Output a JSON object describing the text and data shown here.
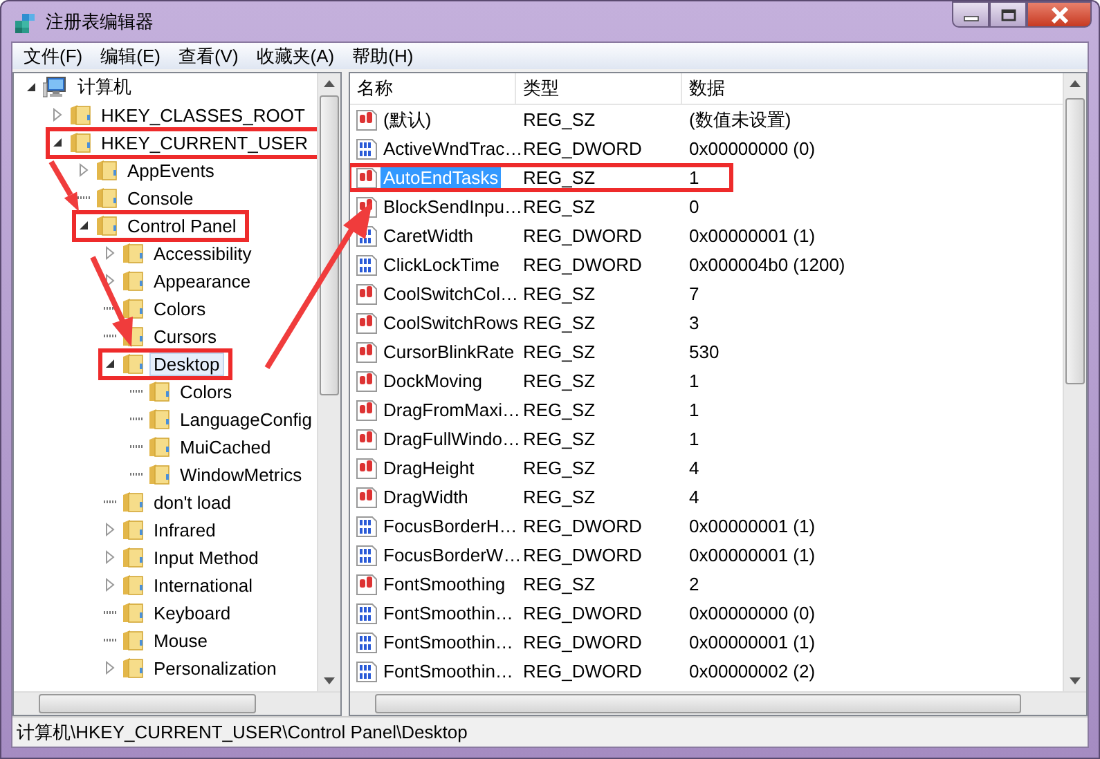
{
  "window": {
    "title": "注册表编辑器"
  },
  "menu": [
    "文件(F)",
    "编辑(E)",
    "查看(V)",
    "收藏夹(A)",
    "帮助(H)"
  ],
  "tree": [
    {
      "label": "计算机",
      "kind": "computer",
      "expandable": true,
      "expanded": true,
      "selected": false,
      "highlighted": false,
      "children": [
        {
          "label": "HKEY_CLASSES_ROOT",
          "kind": "folder",
          "expandable": true,
          "expanded": false,
          "selected": false,
          "highlighted": false
        },
        {
          "label": "HKEY_CURRENT_USER",
          "kind": "folder",
          "expandable": true,
          "expanded": true,
          "selected": false,
          "highlighted": true,
          "children": [
            {
              "label": "AppEvents",
              "kind": "folder",
              "expandable": true,
              "expanded": false,
              "selected": false,
              "highlighted": false
            },
            {
              "label": "Console",
              "kind": "folder",
              "expandable": false,
              "selected": false,
              "highlighted": false
            },
            {
              "label": "Control Panel",
              "kind": "folder",
              "expandable": true,
              "expanded": true,
              "selected": false,
              "highlighted": true,
              "children": [
                {
                  "label": "Accessibility",
                  "kind": "folder",
                  "expandable": true,
                  "expanded": false,
                  "selected": false,
                  "highlighted": false
                },
                {
                  "label": "Appearance",
                  "kind": "folder",
                  "expandable": true,
                  "expanded": false,
                  "selected": false,
                  "highlighted": false
                },
                {
                  "label": "Colors",
                  "kind": "folder",
                  "expandable": false,
                  "selected": false,
                  "highlighted": false
                },
                {
                  "label": "Cursors",
                  "kind": "folder",
                  "expandable": false,
                  "selected": false,
                  "highlighted": false
                },
                {
                  "label": "Desktop",
                  "kind": "folder",
                  "expandable": true,
                  "expanded": true,
                  "selected": true,
                  "highlighted": true,
                  "children": [
                    {
                      "label": "Colors",
                      "kind": "folder",
                      "expandable": false,
                      "selected": false,
                      "highlighted": false
                    },
                    {
                      "label": "LanguageConfig",
                      "kind": "folder",
                      "expandable": false,
                      "selected": false,
                      "highlighted": false
                    },
                    {
                      "label": "MuiCached",
                      "kind": "folder",
                      "expandable": false,
                      "selected": false,
                      "highlighted": false
                    },
                    {
                      "label": "WindowMetrics",
                      "kind": "folder",
                      "expandable": false,
                      "selected": false,
                      "highlighted": false
                    }
                  ]
                },
                {
                  "label": "don't load",
                  "kind": "folder",
                  "expandable": false,
                  "selected": false,
                  "highlighted": false
                },
                {
                  "label": "Infrared",
                  "kind": "folder",
                  "expandable": true,
                  "expanded": false,
                  "selected": false,
                  "highlighted": false
                },
                {
                  "label": "Input Method",
                  "kind": "folder",
                  "expandable": true,
                  "expanded": false,
                  "selected": false,
                  "highlighted": false
                },
                {
                  "label": "International",
                  "kind": "folder",
                  "expandable": true,
                  "expanded": false,
                  "selected": false,
                  "highlighted": false
                },
                {
                  "label": "Keyboard",
                  "kind": "folder",
                  "expandable": false,
                  "selected": false,
                  "highlighted": false
                },
                {
                  "label": "Mouse",
                  "kind": "folder",
                  "expandable": false,
                  "selected": false,
                  "highlighted": false
                },
                {
                  "label": "Personalization",
                  "kind": "folder",
                  "expandable": true,
                  "expanded": false,
                  "selected": false,
                  "highlighted": false
                }
              ]
            }
          ]
        }
      ]
    }
  ],
  "columns": [
    "名称",
    "类型",
    "数据"
  ],
  "values": [
    {
      "name": "(默认)",
      "type": "REG_SZ",
      "data": "(数值未设置)",
      "kind": "sz",
      "selected": false,
      "highlighted": false
    },
    {
      "name": "ActiveWndTrac…",
      "type": "REG_DWORD",
      "data": "0x00000000 (0)",
      "kind": "dword",
      "selected": false,
      "highlighted": false
    },
    {
      "name": "AutoEndTasks",
      "type": "REG_SZ",
      "data": "1",
      "kind": "sz",
      "selected": true,
      "highlighted": true
    },
    {
      "name": "BlockSendInpu…",
      "type": "REG_SZ",
      "data": "0",
      "kind": "sz",
      "selected": false,
      "highlighted": false
    },
    {
      "name": "CaretWidth",
      "type": "REG_DWORD",
      "data": "0x00000001 (1)",
      "kind": "dword",
      "selected": false,
      "highlighted": false
    },
    {
      "name": "ClickLockTime",
      "type": "REG_DWORD",
      "data": "0x000004b0 (1200)",
      "kind": "dword",
      "selected": false,
      "highlighted": false
    },
    {
      "name": "CoolSwitchCol…",
      "type": "REG_SZ",
      "data": "7",
      "kind": "sz",
      "selected": false,
      "highlighted": false
    },
    {
      "name": "CoolSwitchRows",
      "type": "REG_SZ",
      "data": "3",
      "kind": "sz",
      "selected": false,
      "highlighted": false
    },
    {
      "name": "CursorBlinkRate",
      "type": "REG_SZ",
      "data": "530",
      "kind": "sz",
      "selected": false,
      "highlighted": false
    },
    {
      "name": "DockMoving",
      "type": "REG_SZ",
      "data": "1",
      "kind": "sz",
      "selected": false,
      "highlighted": false
    },
    {
      "name": "DragFromMaxi…",
      "type": "REG_SZ",
      "data": "1",
      "kind": "sz",
      "selected": false,
      "highlighted": false
    },
    {
      "name": "DragFullWindo…",
      "type": "REG_SZ",
      "data": "1",
      "kind": "sz",
      "selected": false,
      "highlighted": false
    },
    {
      "name": "DragHeight",
      "type": "REG_SZ",
      "data": "4",
      "kind": "sz",
      "selected": false,
      "highlighted": false
    },
    {
      "name": "DragWidth",
      "type": "REG_SZ",
      "data": "4",
      "kind": "sz",
      "selected": false,
      "highlighted": false
    },
    {
      "name": "FocusBorderH…",
      "type": "REG_DWORD",
      "data": "0x00000001 (1)",
      "kind": "dword",
      "selected": false,
      "highlighted": false
    },
    {
      "name": "FocusBorderW…",
      "type": "REG_DWORD",
      "data": "0x00000001 (1)",
      "kind": "dword",
      "selected": false,
      "highlighted": false
    },
    {
      "name": "FontSmoothing",
      "type": "REG_SZ",
      "data": "2",
      "kind": "sz",
      "selected": false,
      "highlighted": false
    },
    {
      "name": "FontSmoothin…",
      "type": "REG_DWORD",
      "data": "0x00000000 (0)",
      "kind": "dword",
      "selected": false,
      "highlighted": false
    },
    {
      "name": "FontSmoothin…",
      "type": "REG_DWORD",
      "data": "0x00000001 (1)",
      "kind": "dword",
      "selected": false,
      "highlighted": false
    },
    {
      "name": "FontSmoothin…",
      "type": "REG_DWORD",
      "data": "0x00000002 (2)",
      "kind": "dword",
      "selected": false,
      "highlighted": false
    }
  ],
  "status_bar": "计算机\\HKEY_CURRENT_USER\\Control Panel\\Desktop"
}
